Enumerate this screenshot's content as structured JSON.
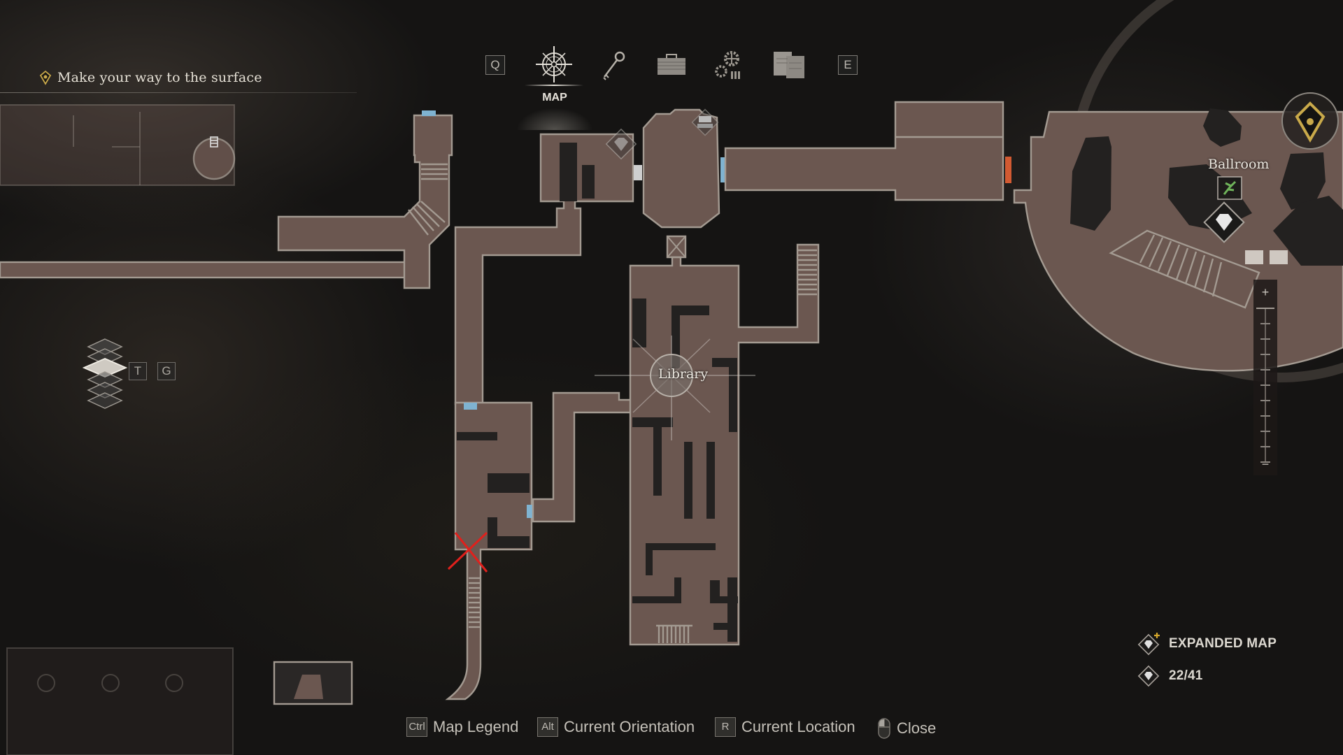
{
  "objective": {
    "icon": "objective-marker-icon",
    "text": "Make your way to the surface"
  },
  "top_nav": {
    "prev_key": "Q",
    "next_key": "E",
    "tabs": [
      {
        "id": "map",
        "icon": "compass-rose-icon",
        "label": "MAP",
        "active": true
      },
      {
        "id": "key-items",
        "icon": "key-icon",
        "label": "",
        "active": false
      },
      {
        "id": "inventory",
        "icon": "briefcase-icon",
        "label": "",
        "active": false
      },
      {
        "id": "upgrades",
        "icon": "gears-ammo-icon",
        "label": "",
        "active": false
      },
      {
        "id": "files",
        "icon": "documents-icon",
        "label": "",
        "active": false
      }
    ]
  },
  "floor_selector": {
    "up_key": "T",
    "down_key": "G",
    "floors": 6,
    "current_floor_index": 2
  },
  "map": {
    "locations": [
      {
        "name": "Library"
      },
      {
        "name": "Ballroom"
      }
    ],
    "markers": [
      {
        "type": "treasure",
        "icon": "diamond-treasure-icon",
        "near": "Ballroom"
      },
      {
        "type": "herb",
        "icon": "green-herb-icon",
        "near": "Ballroom"
      },
      {
        "type": "treasure-collected",
        "icon": "diamond-treasure-icon"
      },
      {
        "type": "typewriter",
        "icon": "typewriter-icon"
      },
      {
        "type": "ladder",
        "icon": "ladder-icon"
      },
      {
        "type": "player-crossed",
        "icon": "red-x-marker-icon"
      },
      {
        "type": "player-position",
        "icon": "player-direction-icon"
      }
    ],
    "colors": {
      "room_fill": "#6b5750",
      "room_outline": "#a39a91",
      "door_unlocked": "#7fb3d1",
      "door_locked": "#d25a32",
      "objective_gold": "#c9a94a",
      "cross_mark": "#e0201c"
    },
    "zoom_level": 1.0
  },
  "zoom_control": {
    "plus": "+",
    "minus": "−"
  },
  "collectibles": {
    "expanded_map_label": "EXPANDED MAP",
    "treasure_count": "22/41"
  },
  "hints": [
    {
      "key": "Ctrl",
      "label": "Map Legend"
    },
    {
      "key": "Alt",
      "label": "Current Orientation"
    },
    {
      "key": "R",
      "label": "Current Location"
    },
    {
      "key": "mouse-icon",
      "label": "Close"
    }
  ]
}
